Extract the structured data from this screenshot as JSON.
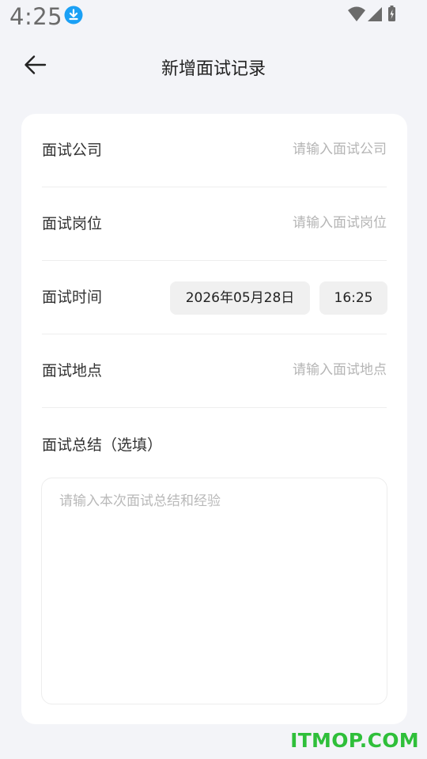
{
  "status_bar": {
    "time": "4:25",
    "icons": [
      "download-icon",
      "wifi-icon",
      "signal-icon",
      "battery-charging-icon"
    ]
  },
  "header": {
    "back_icon": "arrow-left-icon",
    "title": "新增面试记录"
  },
  "form": {
    "company": {
      "label": "面试公司",
      "placeholder": "请输入面试公司",
      "value": ""
    },
    "position": {
      "label": "面试岗位",
      "placeholder": "请输入面试岗位",
      "value": ""
    },
    "time": {
      "label": "面试时间",
      "date": "2026年05月28日",
      "clock": "16:25"
    },
    "location": {
      "label": "面试地点",
      "placeholder": "请输入面试地点",
      "value": ""
    },
    "summary": {
      "label": "面试总结（选填）",
      "placeholder": "请输入本次面试总结和经验",
      "value": ""
    }
  },
  "watermark": "ITMOP.COM",
  "colors": {
    "background": "#f3f4f8",
    "card": "#ffffff",
    "chip": "#f0f0f0",
    "placeholder": "#b5b5b5",
    "download_badge": "#1aa0f5",
    "watermark": "#2fbf3a"
  }
}
